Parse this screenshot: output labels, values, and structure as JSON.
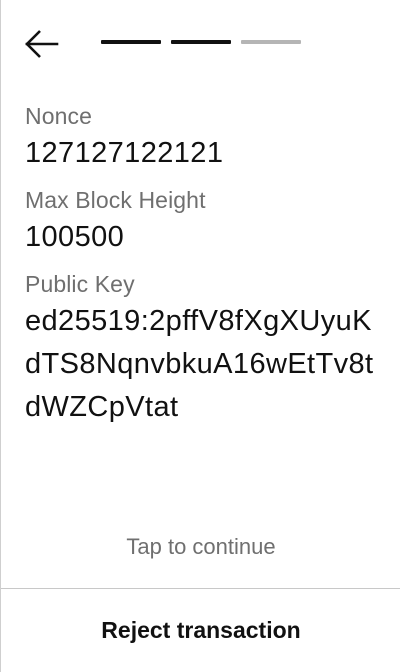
{
  "header": {
    "back_icon": "back-arrow-icon",
    "progress": {
      "total_steps": 3,
      "completed_steps": 2,
      "active_color": "#111111",
      "inactive_color": "#b5b5b5"
    }
  },
  "fields": [
    {
      "label": "Nonce",
      "value": "127127122121"
    },
    {
      "label": "Max Block Height",
      "value": "100500"
    },
    {
      "label": "Public Key",
      "value": "ed25519:2pffV8fXgXUyuKdTS8NqnvbkuA16wEtTv8tdWZCpVtat"
    }
  ],
  "footer": {
    "tap_hint": "Tap to continue",
    "reject_label": "Reject transaction"
  }
}
